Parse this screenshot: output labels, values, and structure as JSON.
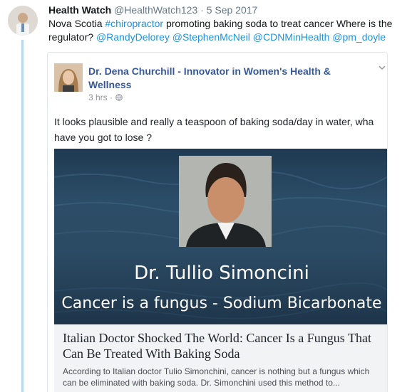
{
  "tweet": {
    "name": "Health Watch",
    "handle": "@HealthWatch123",
    "date": "5 Sep 2017",
    "text_part1": "Nova Scotia ",
    "hashtag": "#chiropractor",
    "text_part2": " promoting baking soda to treat cancer Where is the regulator? ",
    "mentions": [
      "@RandyDelorey",
      "@StephenMcNeil",
      "@CDNMinHealth",
      "@pm_doyle"
    ]
  },
  "fb_post": {
    "author": "Dr. Dena Churchill - Innovator in Women's Health & Wellness",
    "time": "3 hrs",
    "privacy_icon": "globe-icon",
    "text_line1": "It looks plausible and really a teaspoon of baking soda/day in water, wha",
    "text_line2": "have you got to lose ?"
  },
  "shared_link": {
    "image_title": "Dr. Tullio Simoncini",
    "image_subtitle": "Cancer is a fungus - Sodium Bicarbonate",
    "headline": "Italian Doctor Shocked The World: Cancer Is a Fungus That Can Be Treated With Baking Soda",
    "description": "According to Italian doctor Tulio Simonchini, cancer is nothing but a fungus which can be eliminated with baking soda. Dr. Simonchini used this method to..."
  },
  "colors": {
    "link": "#1b95e0",
    "fb_name": "#365899",
    "thread_line": "#b6d8f0"
  }
}
